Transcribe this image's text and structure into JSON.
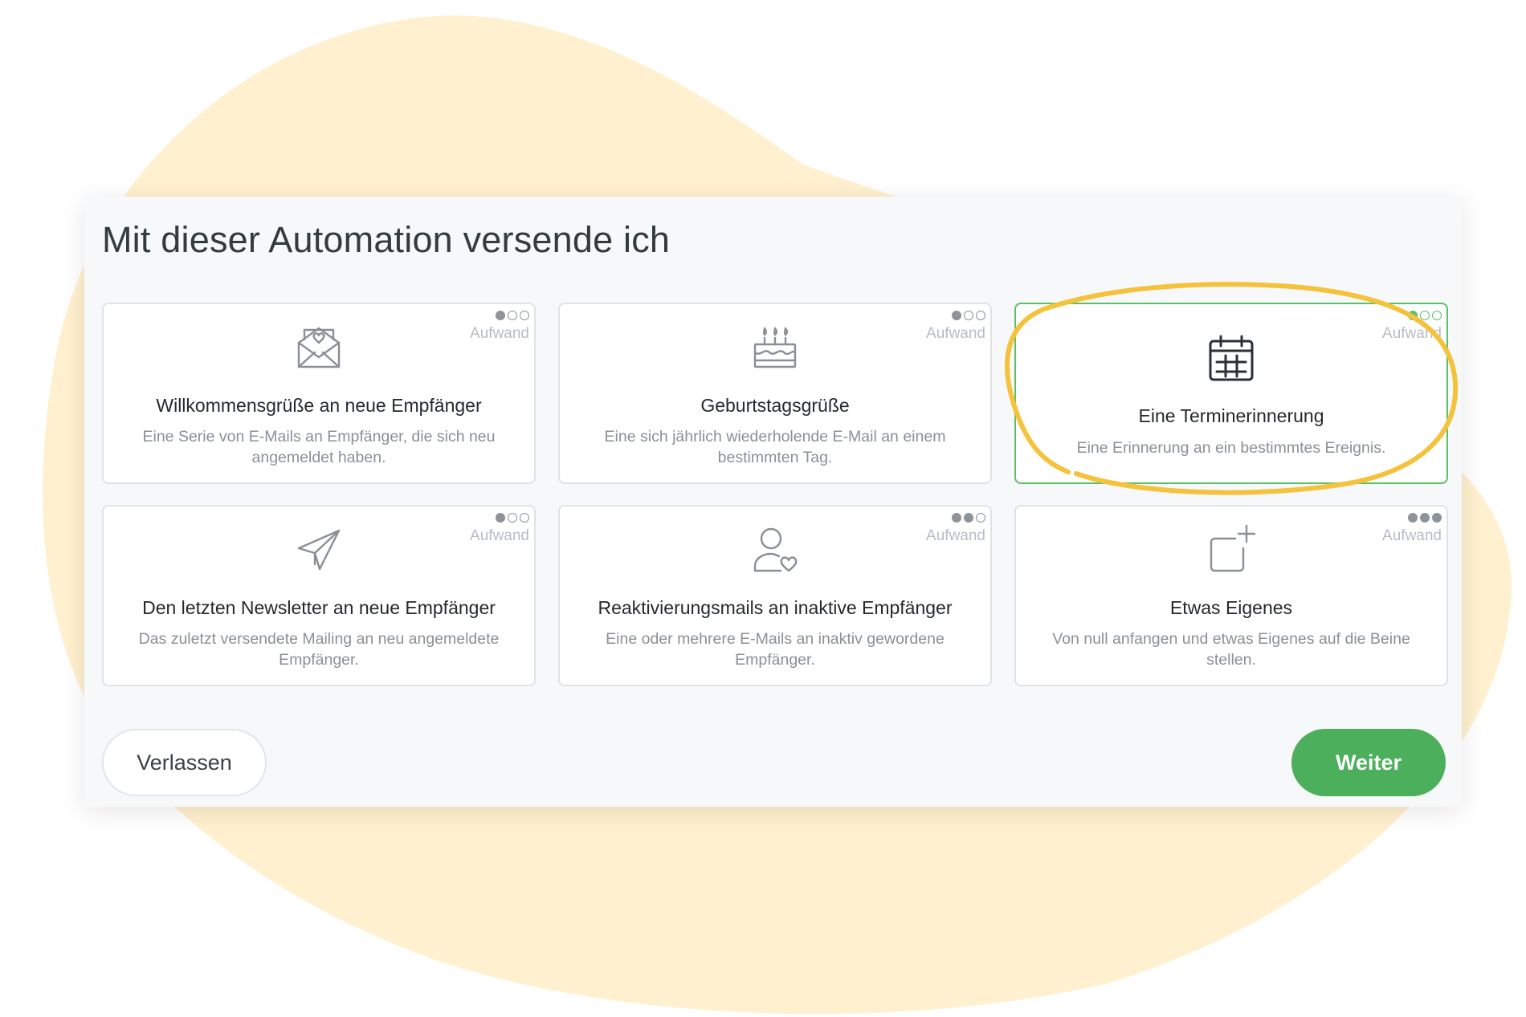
{
  "colors": {
    "blob": "#fff0cf",
    "accent_green": "#4caf5c",
    "selected_border": "#5cc06b",
    "highlight_ring": "#f5c23c"
  },
  "panel": {
    "title": "Mit dieser Automation versende ich"
  },
  "cards": [
    {
      "icon": "envelope-heart-icon",
      "effort_level": 1,
      "effort_label": "Aufwand",
      "title": "Willkommensgrüße an neue Empfänger",
      "description": "Eine Serie von E-Mails an Empfänger, die sich neu angemeldet haben.",
      "selected": false
    },
    {
      "icon": "birthday-cake-icon",
      "effort_level": 1,
      "effort_label": "Aufwand",
      "title": "Geburtstagsgrüße",
      "description": "Eine sich jährlich wiederholende E-Mail an einem bestimmten Tag.",
      "selected": false
    },
    {
      "icon": "calendar-icon",
      "effort_level": 1,
      "effort_label": "Aufwand",
      "title": "Eine Terminerinnerung",
      "description": "Eine Erinnerung an ein bestimmtes Ereignis.",
      "selected": true
    },
    {
      "icon": "paper-plane-icon",
      "effort_level": 1,
      "effort_label": "Aufwand",
      "title": "Den letzten Newsletter an neue Empfänger",
      "description": "Das zuletzt versendete Mailing an neu angemeldete Empfänger.",
      "selected": false
    },
    {
      "icon": "user-heart-icon",
      "effort_level": 2,
      "effort_label": "Aufwand",
      "title": "Reaktivierungsmails an inaktive Empfänger",
      "description": "Eine oder mehrere E-Mails an inaktiv gewordene Empfänger.",
      "selected": false
    },
    {
      "icon": "add-square-icon",
      "effort_level": 3,
      "effort_label": "Aufwand",
      "title": "Etwas Eigenes",
      "description": "Von null anfangen und etwas Eigenes auf die Beine stellen.",
      "selected": false
    }
  ],
  "footer": {
    "leave_label": "Verlassen",
    "next_label": "Weiter"
  }
}
